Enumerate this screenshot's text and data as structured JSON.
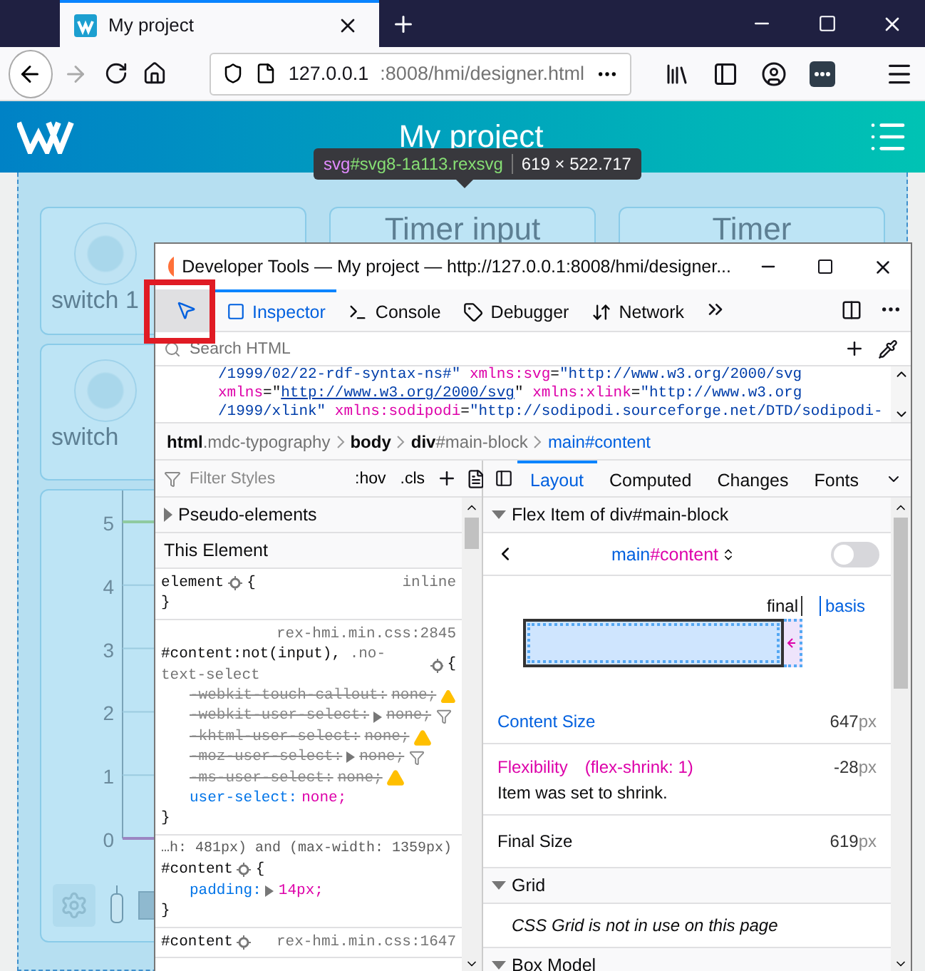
{
  "browser": {
    "tab": {
      "title": "My project"
    },
    "url": {
      "host": "127.0.0.1",
      "rest": ":8008/hmi/designer.html"
    }
  },
  "page": {
    "title": "My project",
    "tiles": [
      {
        "label": "switch 1",
        "kind": "switch"
      },
      {
        "label": "Timer input",
        "kind": "timer"
      },
      {
        "label": "Timer",
        "kind": "timer"
      },
      {
        "label": "switch",
        "kind": "switch"
      }
    ],
    "chart": {
      "y_labels": [
        "5",
        "4",
        "3",
        "2",
        "1",
        "0"
      ]
    }
  },
  "tooltip": {
    "tag": "svg",
    "id": "#svg8-1a113.rexsvg",
    "size": "619 × 522.717"
  },
  "devtools": {
    "title": "Developer Tools — My project — http://127.0.0.1:8008/hmi/designer...",
    "picker": {
      "selected": true,
      "highlighted": true
    },
    "tabs": [
      {
        "label": "Inspector",
        "kind": "inspector",
        "selected": true
      },
      {
        "label": "Console",
        "kind": "console",
        "selected": false
      },
      {
        "label": "Debugger",
        "kind": "debugger",
        "selected": false
      },
      {
        "label": "Network",
        "kind": "network",
        "selected": false
      }
    ],
    "search": {
      "placeholder": "Search HTML"
    },
    "markup": [
      [
        {
          "kind": "value",
          "text": "/1999/02/22-rdf-syntax-ns#\""
        },
        {
          "kind": "attr",
          "text": " xmlns:svg"
        },
        {
          "kind": "punct",
          "text": "="
        },
        {
          "kind": "value",
          "text": "\"http://www.w3.org/2000/svg"
        }
      ],
      [
        {
          "kind": "attr",
          "text": "xmlns"
        },
        {
          "kind": "punct",
          "text": "=\""
        },
        {
          "kind": "link",
          "text": "http://www.w3.org/2000/svg"
        },
        {
          "kind": "punct",
          "text": "\""
        },
        {
          "kind": "attr",
          "text": " xmlns:xlink"
        },
        {
          "kind": "punct",
          "text": "="
        },
        {
          "kind": "value",
          "text": "\"http://www.w3.org"
        }
      ],
      [
        {
          "kind": "value",
          "text": "/1999/xlink\""
        },
        {
          "kind": "attr",
          "text": " xmlns:sodipodi"
        },
        {
          "kind": "punct",
          "text": "="
        },
        {
          "kind": "value",
          "text": "\"http://sodipodi.sourceforge.net/DTD/sodipodi-"
        }
      ]
    ],
    "breadcrumbs": [
      {
        "tag": "html",
        "extra": ".mdc-typography",
        "selected": false
      },
      {
        "tag": "body",
        "selected": false
      },
      {
        "tag": "div",
        "extra": "#main-block",
        "selected": false
      },
      {
        "tag": "main",
        "extra": "#content",
        "selected": true
      }
    ],
    "styles": {
      "filter_placeholder": "Filter Styles",
      "hov": ":hov",
      "cls": ".cls",
      "pseudo": {
        "label": "Pseudo-elements",
        "expanded": false
      },
      "this_element": "This Element",
      "rules": [
        {
          "selector": "element",
          "open": "{",
          "source": "inline",
          "close": "}"
        },
        {
          "source": "rex-hmi.min.css:2845",
          "selector": "#content:not(input),",
          "selector_extra": " .no-text-select",
          "open": "{",
          "declarations": [
            {
              "prop": "-webkit-touch-callout:",
              "value": "none;",
              "overridden": true,
              "expandable": false,
              "warning": true,
              "filtered": false
            },
            {
              "prop": "-webkit-user-select:",
              "value": "none;",
              "overridden": true,
              "expandable": true,
              "warning": false,
              "filtered": true
            },
            {
              "prop": "-khtml-user-select:",
              "value": "none;",
              "overridden": true,
              "expandable": false,
              "warning": true,
              "filtered": false
            },
            {
              "prop": "-moz-user-select:",
              "value": "none;",
              "overridden": true,
              "expandable": true,
              "warning": false,
              "filtered": true
            },
            {
              "prop": "-ms-user-select:",
              "value": "none;",
              "overridden": true,
              "expandable": false,
              "warning": true,
              "filtered": false
            },
            {
              "prop": "user-select:",
              "value": "none;",
              "overridden": false,
              "expandable": false,
              "warning": false,
              "filtered": false
            }
          ],
          "close": "}"
        },
        {
          "media": "…h: 481px) and (max-width: 1359px)",
          "selector": "#content",
          "open": "{",
          "declarations": [
            {
              "prop": "padding:",
              "value": "14px;",
              "overridden": false,
              "expandable": true,
              "warning": false,
              "filtered": false
            }
          ],
          "close": "}"
        },
        {
          "selector": "#content",
          "source": "rex-hmi.min.css:1647"
        }
      ]
    },
    "layout": {
      "tabs": [
        {
          "label": "Layout",
          "selected": true
        },
        {
          "label": "Computed",
          "selected": false
        },
        {
          "label": "Changes",
          "selected": false
        },
        {
          "label": "Fonts",
          "selected": false
        }
      ],
      "flex_section": {
        "label": "Flex Item of div#main-block",
        "expanded": true
      },
      "element": {
        "tag": "main",
        "id": "#content"
      },
      "toggle": {
        "on": false
      },
      "diagram": {
        "final": "final",
        "basis": "basis"
      },
      "rows": [
        {
          "label": "Content Size",
          "kind": "content",
          "value": "647",
          "unit": "px"
        },
        {
          "label": "Flexibility",
          "kind": "flex",
          "detail": "(flex-shrink: 1)",
          "value": "-28",
          "unit": "px",
          "note": "Item was set to shrink."
        },
        {
          "label": "Final Size",
          "kind": "final",
          "value": "619",
          "unit": "px"
        }
      ],
      "grid_section": {
        "label": "Grid",
        "expanded": true,
        "note": "CSS Grid is not in use on this page"
      },
      "box_section": {
        "label": "Box Model",
        "expanded": true
      }
    }
  }
}
